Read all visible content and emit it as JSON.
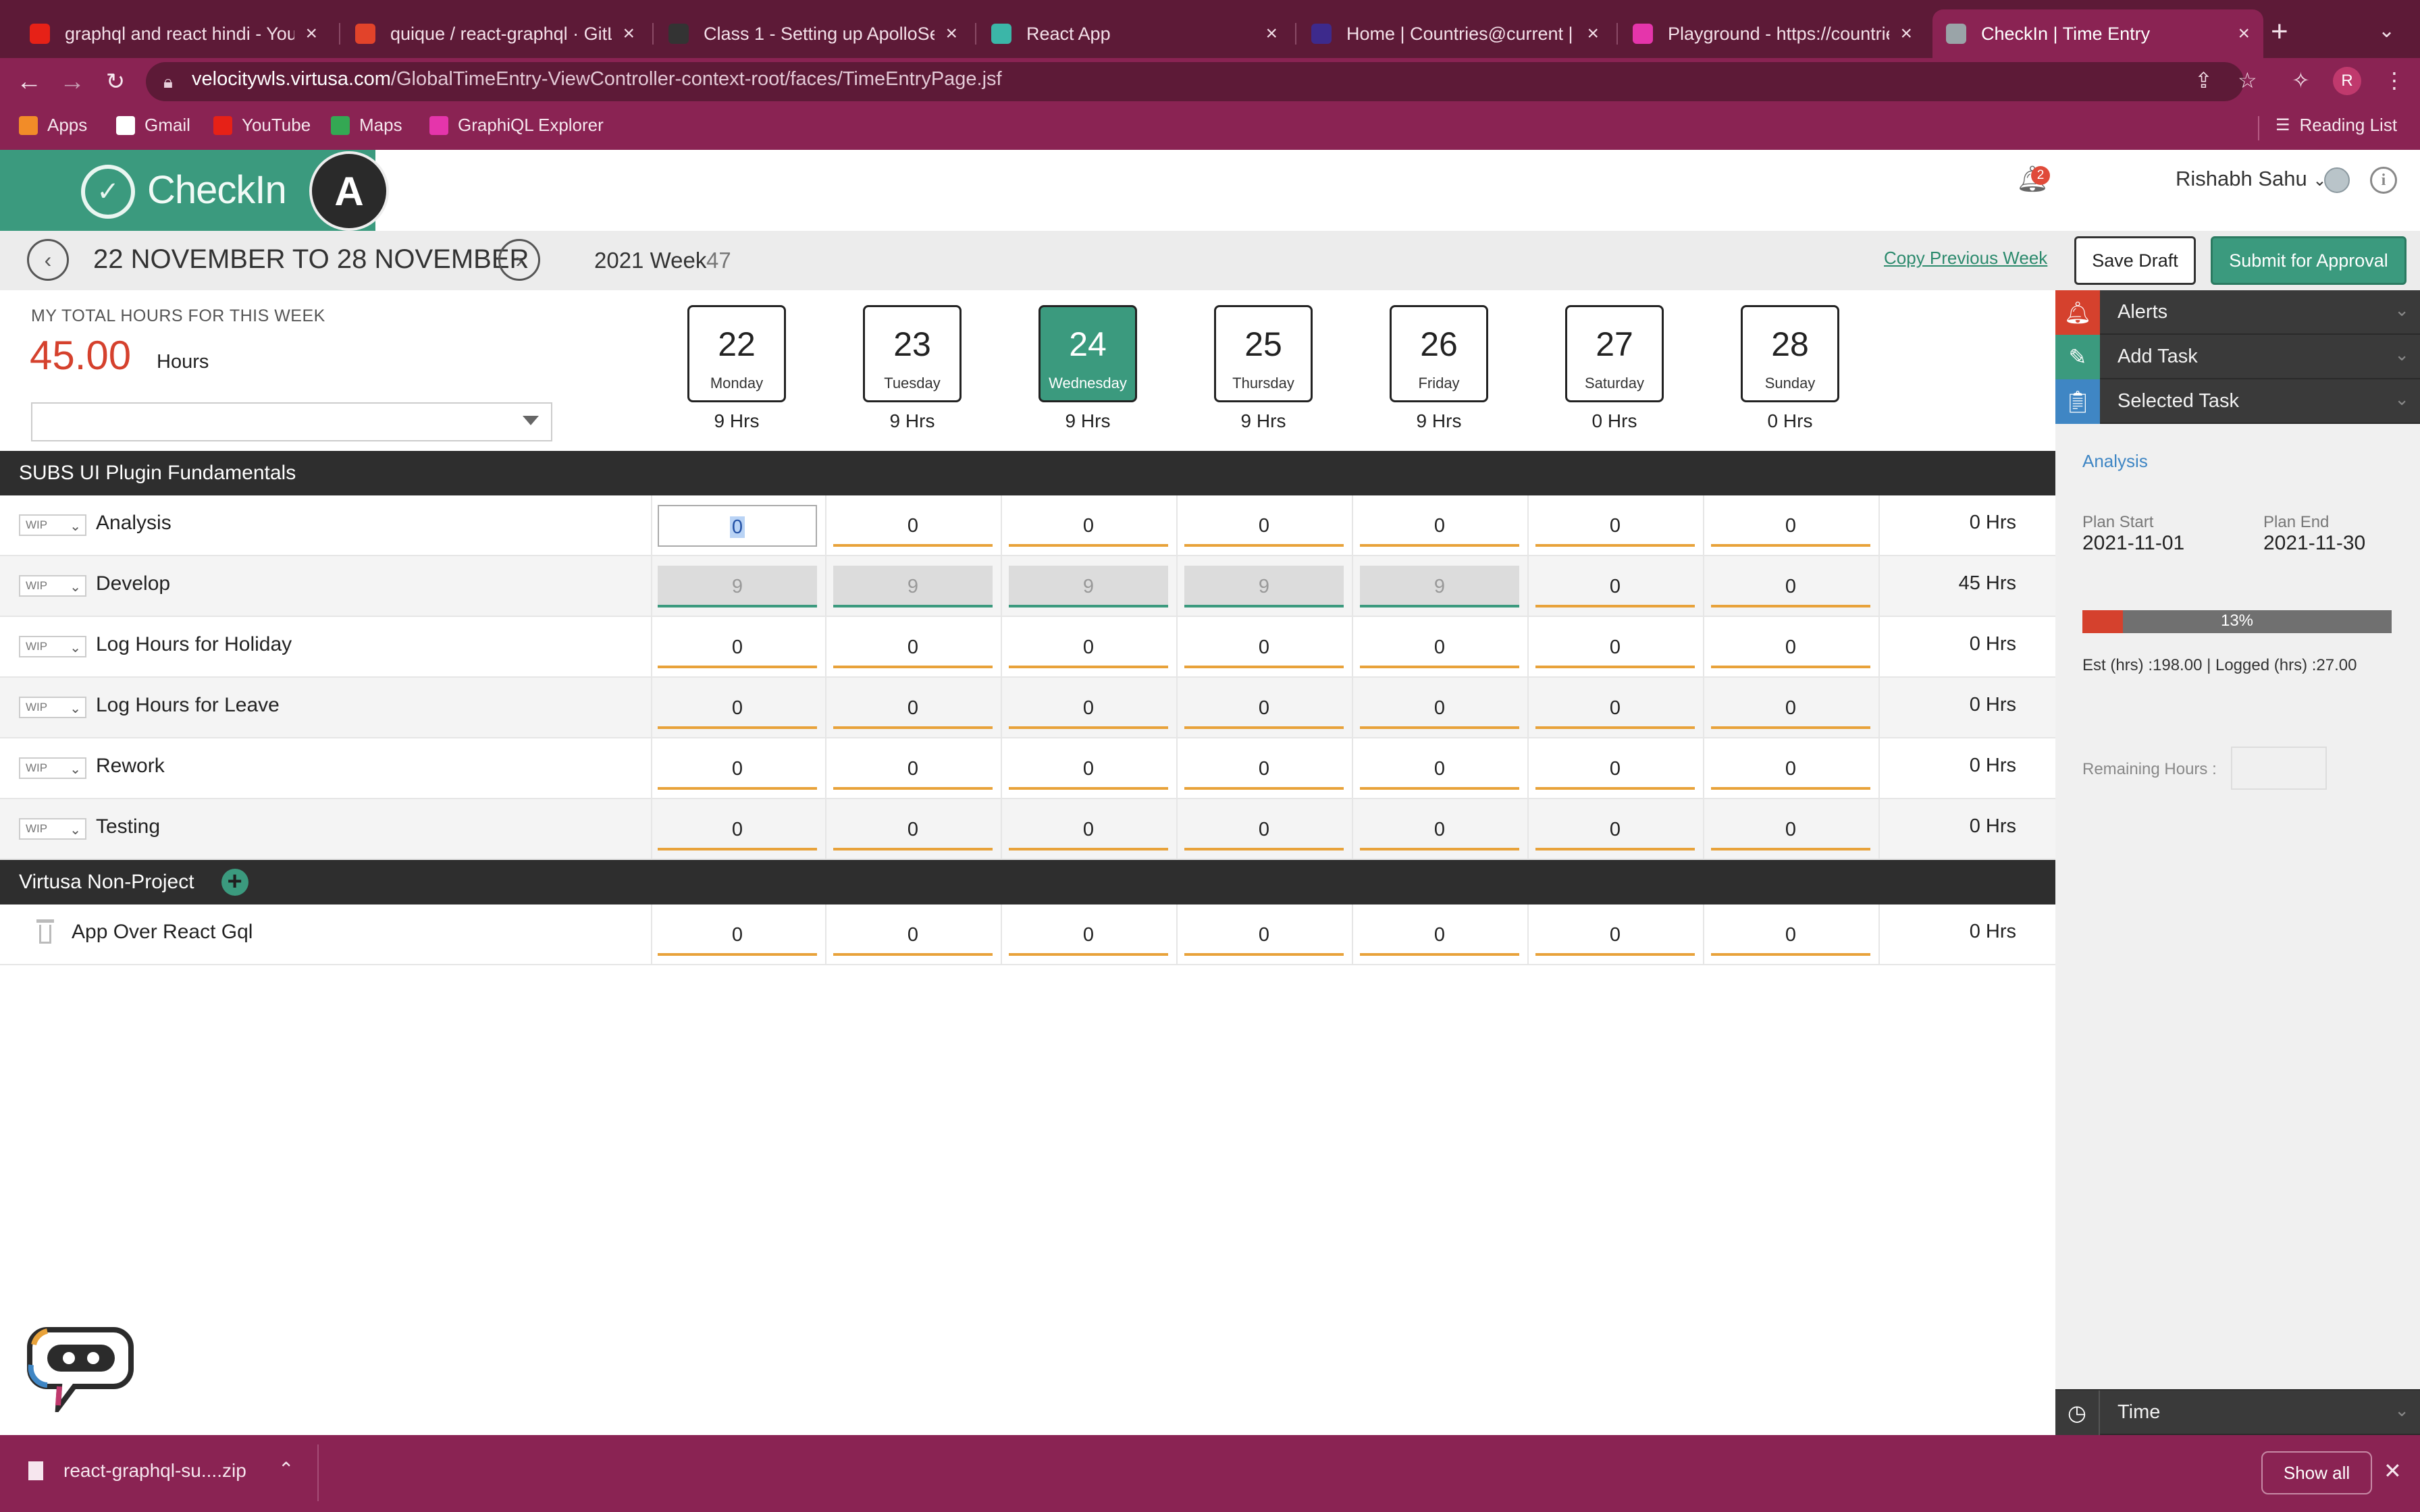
{
  "browser": {
    "tabs": [
      {
        "title": "graphql and react hindi - YouTube",
        "fav_color": "#e62117",
        "active": false
      },
      {
        "title": "quique / react-graphql · GitLab",
        "fav_color": "#e2432a",
        "active": false
      },
      {
        "title": "Class 1 - Setting up ApolloServer",
        "fav_color": "#333333",
        "active": false
      },
      {
        "title": "React App",
        "fav_color": "#3bb6a8",
        "active": false
      },
      {
        "title": "Home | Countries@current | Studio",
        "fav_color": "#3d2a8c",
        "active": false
      },
      {
        "title": "Playground - https://countries.trevorblades.com",
        "fav_color": "#e535ab",
        "active": false
      },
      {
        "title": "CheckIn | Time Entry",
        "fav_color": "#9aa4a8",
        "active": true
      }
    ],
    "url_host": "velocitywls.virtusa.com",
    "url_path": "/GlobalTimeEntry-ViewController-context-root/faces/TimeEntryPage.jsf",
    "profile_initial": "R",
    "bookmarks": [
      {
        "label": "Apps",
        "color": "#f28c28"
      },
      {
        "label": "Gmail",
        "color": "#ffffff"
      },
      {
        "label": "YouTube",
        "color": "#e62117"
      },
      {
        "label": "Maps",
        "color": "#34a853"
      },
      {
        "label": "GraphiQL Explorer",
        "color": "#e535ab"
      }
    ],
    "reading_list": "Reading List"
  },
  "app": {
    "logo_text": "CheckIn",
    "notification_count": "2",
    "user_name": "Rishabh Sahu",
    "week_range": "22 NOVEMBER TO 28 NOVEMBER",
    "week_year": "2021 Week",
    "week_number": "47",
    "copy_previous": "Copy Previous Week",
    "save_draft": "Save Draft",
    "submit": "Submit for Approval",
    "total_label": "MY TOTAL HOURS FOR THIS WEEK",
    "total_value": "45.00",
    "total_unit": "Hours",
    "days": [
      {
        "num": "22",
        "name": "Monday",
        "hrs": "9 Hrs",
        "today": false
      },
      {
        "num": "23",
        "name": "Tuesday",
        "hrs": "9 Hrs",
        "today": false
      },
      {
        "num": "24",
        "name": "Wednesday",
        "hrs": "9 Hrs",
        "today": true
      },
      {
        "num": "25",
        "name": "Thursday",
        "hrs": "9 Hrs",
        "today": false
      },
      {
        "num": "26",
        "name": "Friday",
        "hrs": "9 Hrs",
        "today": false
      },
      {
        "num": "27",
        "name": "Saturday",
        "hrs": "0 Hrs",
        "today": false
      },
      {
        "num": "28",
        "name": "Sunday",
        "hrs": "0 Hrs",
        "today": false
      }
    ],
    "projects": [
      {
        "name": "SUBS UI Plugin Fundamentals",
        "addable": false,
        "tasks": [
          {
            "status": "WIP",
            "name": "Analysis",
            "values": [
              "0",
              "0",
              "0",
              "0",
              "0",
              "0",
              "0"
            ],
            "locked": [
              false,
              false,
              false,
              false,
              false,
              false,
              false
            ],
            "total": "0 Hrs",
            "focus_index": 0
          },
          {
            "status": "WIP",
            "name": "Develop",
            "values": [
              "9",
              "9",
              "9",
              "9",
              "9",
              "0",
              "0"
            ],
            "locked": [
              true,
              true,
              true,
              true,
              true,
              false,
              false
            ],
            "total": "45 Hrs",
            "focus_index": -1
          },
          {
            "status": "WIP",
            "name": "Log Hours for Holiday",
            "values": [
              "0",
              "0",
              "0",
              "0",
              "0",
              "0",
              "0"
            ],
            "locked": [
              false,
              false,
              false,
              false,
              false,
              false,
              false
            ],
            "total": "0 Hrs",
            "focus_index": -1
          },
          {
            "status": "WIP",
            "name": "Log Hours for Leave",
            "values": [
              "0",
              "0",
              "0",
              "0",
              "0",
              "0",
              "0"
            ],
            "locked": [
              false,
              false,
              false,
              false,
              false,
              false,
              false
            ],
            "total": "0 Hrs",
            "focus_index": -1
          },
          {
            "status": "WIP",
            "name": "Rework",
            "values": [
              "0",
              "0",
              "0",
              "0",
              "0",
              "0",
              "0"
            ],
            "locked": [
              false,
              false,
              false,
              false,
              false,
              false,
              false
            ],
            "total": "0 Hrs",
            "focus_index": -1
          },
          {
            "status": "WIP",
            "name": "Testing",
            "values": [
              "0",
              "0",
              "0",
              "0",
              "0",
              "0",
              "0"
            ],
            "locked": [
              false,
              false,
              false,
              false,
              false,
              false,
              false
            ],
            "total": "0 Hrs",
            "focus_index": -1
          }
        ]
      },
      {
        "name": "Virtusa Non-Project",
        "addable": true,
        "tasks": [
          {
            "status": "",
            "name": "App Over React Gql",
            "deletable": true,
            "values": [
              "0",
              "0",
              "0",
              "0",
              "0",
              "0",
              "0"
            ],
            "locked": [
              false,
              false,
              false,
              false,
              false,
              false,
              false
            ],
            "total": "0 Hrs",
            "focus_index": -1
          }
        ]
      }
    ],
    "panel": {
      "alerts": "Alerts",
      "add_task": "Add Task",
      "selected_task": "Selected Task",
      "task_name": "Analysis",
      "plan_start_label": "Plan Start",
      "plan_start": "2021-11-01",
      "plan_end_label": "Plan End",
      "plan_end": "2021-11-30",
      "progress_percent": 13,
      "progress_text": "13%",
      "est_logged": "Est (hrs) :198.00   |   Logged (hrs) :27.00",
      "remaining_label": "Remaining Hours :",
      "time": "Time"
    }
  },
  "download": {
    "file": "react-graphql-su....zip",
    "show_all": "Show all"
  },
  "colors": {
    "brand_green": "#3b9a7e",
    "accent_red": "#d5412d",
    "browser_theme": "#8a2353",
    "input_underline": "#e8a23a"
  }
}
